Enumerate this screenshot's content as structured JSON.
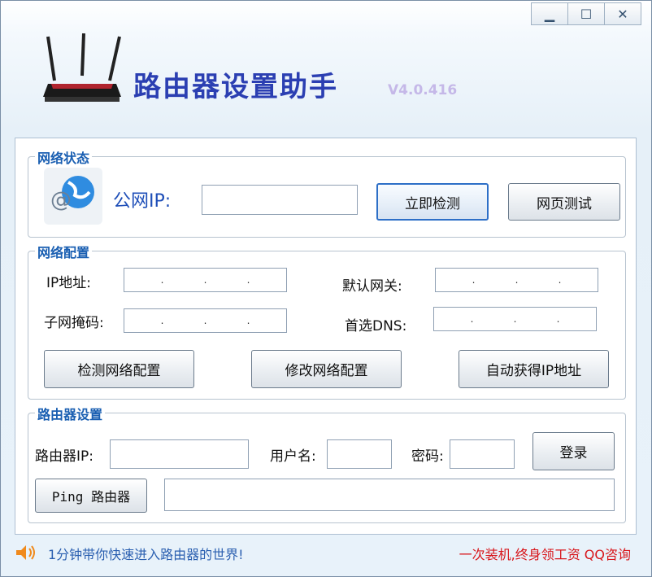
{
  "window": {
    "minimize_icon": "minimize-icon",
    "maximize_icon": "maximize-icon",
    "close_icon": "close-icon"
  },
  "header": {
    "title": "路由器设置助手",
    "version": "V4.0.416"
  },
  "status": {
    "title": "网络状态",
    "public_ip_label": "公网IP:",
    "public_ip_value": "",
    "check_now": "立即检测",
    "web_test": "网页测试"
  },
  "config": {
    "title": "网络配置",
    "ip_label": "IP地址:",
    "gateway_label": "默认网关:",
    "mask_label": "子网掩码:",
    "dns_label": "首选DNS:",
    "ip_dots": [
      ".",
      ".",
      "."
    ],
    "check_config": "检测网络配置",
    "modify_config": "修改网络配置",
    "auto_ip": "自动获得IP地址"
  },
  "router": {
    "title": "路由器设置",
    "ip_label": "路由器IP:",
    "user_label": "用户名:",
    "pwd_label": "密码:",
    "login": "登录",
    "ping": "Ping 路由器",
    "ip_value": "",
    "user_value": "",
    "pwd_value": "",
    "ping_output": ""
  },
  "footer": {
    "left": "1分钟带你快速进入路由器的世界!",
    "right": "一次装机,终身领工资  QQ咨询"
  },
  "colors": {
    "title": "#2b3fb2",
    "group_title": "#1a5fb2",
    "footer_right": "#d8161b"
  }
}
